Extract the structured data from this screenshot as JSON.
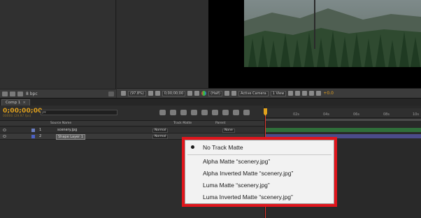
{
  "project": {
    "bpc_label": "8 bpc"
  },
  "comp_toolbar": {
    "zoom": "(97.8%)",
    "timecode": "0;00;00;00",
    "resolution": "(Half)",
    "camera": "Active Camera",
    "views": "1 View",
    "exposure": "+0.0"
  },
  "timeline": {
    "tab_label": "Comp 1",
    "current_time": "0;00;00;00",
    "frame_info": "00000 (29.97 fps)",
    "search_placeholder": "ρ▾",
    "ruler_labels": [
      "02s",
      "04s",
      "06s",
      "08s",
      "10s"
    ],
    "columns": {
      "source_name": "Source Name",
      "track_matte": "Track Matte",
      "parent": "Parent"
    },
    "layers": [
      {
        "num": "1",
        "name": "scenery.jpg",
        "mode": "Normal",
        "parent": "None",
        "label_color": "#6a7dbf"
      },
      {
        "num": "2",
        "name": "Shape Layer 1",
        "mode": "Normal",
        "parent": "None",
        "label_color": "#4c61c4"
      }
    ]
  },
  "track_matte_menu": {
    "items": [
      {
        "label": "No Track Matte",
        "checked": true
      },
      {
        "label": "Alpha Matte “scenery.jpg”",
        "checked": false
      },
      {
        "label": "Alpha Inverted Matte “scenery.jpg”",
        "checked": false
      },
      {
        "label": "Luma Matte “scenery.jpg”",
        "checked": false
      },
      {
        "label": "Luma Inverted Matte “scenery.jpg”",
        "checked": false
      }
    ]
  },
  "colors": {
    "timecode": "#e2a21c",
    "playhead": "#e3342b",
    "highlight": "#e0151c",
    "layer1_bar": "#2f6e3a",
    "layer2_bar": "#4b4b8a"
  }
}
